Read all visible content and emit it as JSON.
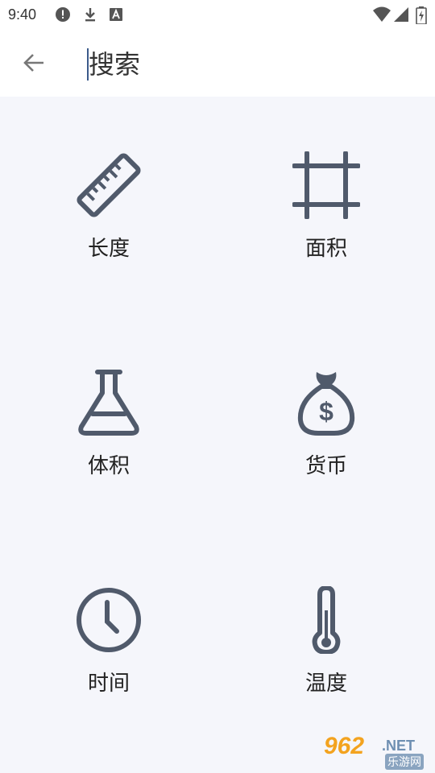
{
  "status_bar": {
    "time": "9:40",
    "left_icons": [
      "alert-icon",
      "download-icon",
      "keyboard-a-icon"
    ],
    "right_icons": [
      "wifi-icon",
      "signal-icon",
      "battery-charging-icon"
    ]
  },
  "header": {
    "search_placeholder": "搜索",
    "back_icon": "arrow-left-icon"
  },
  "categories": [
    {
      "label": "长度",
      "icon": "ruler-icon"
    },
    {
      "label": "面积",
      "icon": "crop-area-icon"
    },
    {
      "label": "体积",
      "icon": "flask-icon"
    },
    {
      "label": "货币",
      "icon": "money-bag-icon"
    },
    {
      "label": "时间",
      "icon": "clock-icon"
    },
    {
      "label": "温度",
      "icon": "thermometer-icon"
    }
  ],
  "watermark": {
    "brand": "962",
    "suffix": ".NET",
    "subtitle": "乐游网"
  },
  "colors": {
    "icon": "#505a6b",
    "background": "#f5f6fb",
    "header": "#ffffff",
    "cursor": "#3b5a8a"
  }
}
